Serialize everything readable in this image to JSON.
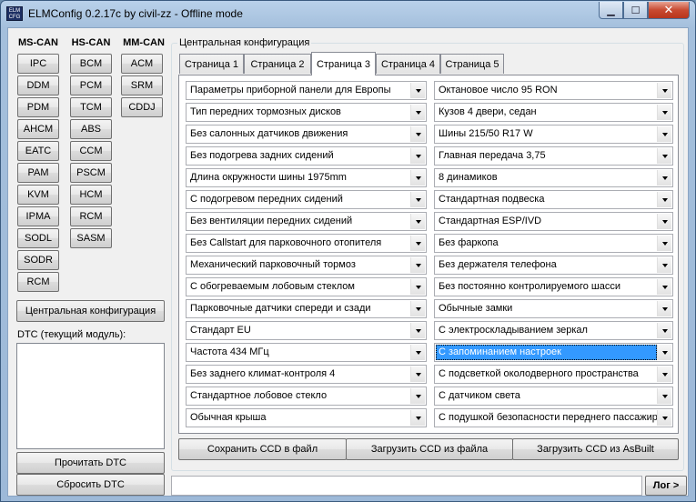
{
  "window": {
    "title": "ELMConfig 0.2.17c by civil-zz - Offline mode",
    "icon_text": "ELM\nCONFIG",
    "min_glyph": "▁",
    "max_glyph": "☐",
    "close_glyph": "✕"
  },
  "modules": {
    "ms_can_title": "MS-CAN",
    "hs_can_title": "HS-CAN",
    "mm_can_title": "MM-CAN",
    "ms_can": [
      "IPC",
      "DDM",
      "PDM",
      "AHCM",
      "EATC",
      "PAM",
      "KVM",
      "IPMA",
      "SODL",
      "SODR",
      "RCM"
    ],
    "hs_can": [
      "BCM",
      "PCM",
      "TCM",
      "ABS",
      "CCM",
      "PSCM",
      "HCM",
      "RCM",
      "SASM"
    ],
    "mm_can": [
      "ACM",
      "SRM",
      "CDDJ"
    ]
  },
  "central_config_button": "Центральная конфигурация",
  "dtc": {
    "label": "DTC (текущий модуль):",
    "read_button": "Прочитать DTC",
    "reset_button": "Сбросить DTC"
  },
  "config": {
    "group_title": "Центральная конфигурация",
    "tabs": [
      "Страница 1",
      "Страница 2",
      "Страница 3",
      "Страница 4",
      "Страница 5"
    ],
    "active_tab": "Страница 3",
    "left_options": [
      "Параметры приборной панели для Европы",
      "Тип передних тормозных дисков",
      "Без салонных датчиков движения",
      "Без подогрева задних сидений",
      "Длина окружности шины 1975mm",
      "С подогревом передних сидений",
      "Без вентиляции передних сидений",
      "Без Callstart для парковочного отопителя",
      "Механический парковочный тормоз",
      "С обогреваемым лобовым стеклом",
      "Парковочные датчики спереди и сзади",
      "Стандарт EU",
      "Частота 434 МГц",
      "Без заднего климат-контроля 4",
      "Стандартное лобовое стекло",
      "Обычная крыша"
    ],
    "right_options": [
      "Октановое число 95 RON",
      "Кузов 4 двери, седан",
      "Шины 215/50 R17 W",
      "Главная передача 3,75",
      "8 динамиков",
      "Стандартная подвеска",
      "Стандартная ESP/IVD",
      "Без фаркопа",
      "Без держателя телефона",
      "Без постоянно контролируемого шасси",
      "Обычные замки",
      "С электроскладыванием зеркал",
      "С запоминанием настроек",
      "С подсветкой околодверного пространства",
      "С датчиком света",
      "С подушкой безопасности переднего пассажира"
    ],
    "selected_right_index": 12
  },
  "actions": {
    "save_ccd": "Сохранить CCD в файл",
    "load_ccd": "Загрузить CCD из файла",
    "load_asbuilt": "Загрузить CCD из AsBuilt"
  },
  "log_button": "Лог >"
}
